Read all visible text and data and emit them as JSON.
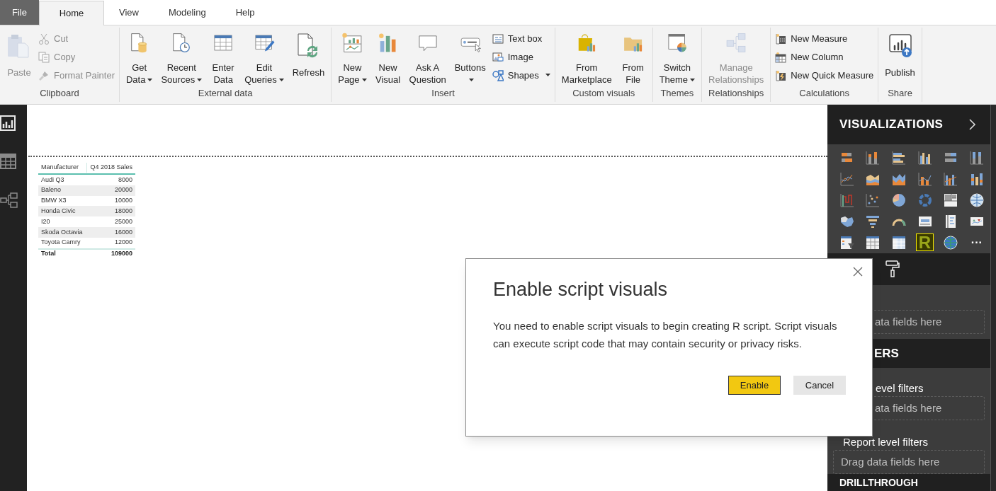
{
  "tabs": [
    {
      "label": "File",
      "kind": "file",
      "selected": false
    },
    {
      "label": "Home",
      "kind": "tab",
      "selected": true
    },
    {
      "label": "View",
      "kind": "tab",
      "selected": false
    },
    {
      "label": "Modeling",
      "kind": "tab",
      "selected": false
    },
    {
      "label": "Help",
      "kind": "tab",
      "selected": false
    }
  ],
  "ribbon": {
    "groups": [
      {
        "label": "Clipboard",
        "items": [
          {
            "kind": "large",
            "lines": [
              "Paste"
            ],
            "dropdown": false,
            "disabled": true
          },
          {
            "kind": "stack",
            "items": [
              {
                "label": "Cut",
                "dropdown": false,
                "disabled": true
              },
              {
                "label": "Copy",
                "dropdown": false,
                "disabled": true
              },
              {
                "label": "Format Painter",
                "dropdown": false,
                "disabled": true
              }
            ]
          }
        ]
      },
      {
        "label": "External data",
        "items": [
          {
            "kind": "large",
            "lines": [
              "Get",
              "Data"
            ],
            "dropdown": true,
            "disabled": false
          },
          {
            "kind": "large",
            "lines": [
              "Recent",
              "Sources"
            ],
            "dropdown": true,
            "disabled": false
          },
          {
            "kind": "large",
            "lines": [
              "Enter",
              "Data"
            ],
            "dropdown": false,
            "disabled": false
          },
          {
            "kind": "large",
            "lines": [
              "Edit",
              "Queries"
            ],
            "dropdown": true,
            "disabled": false
          },
          {
            "kind": "large",
            "lines": [
              "Refresh"
            ],
            "dropdown": false,
            "disabled": false
          }
        ]
      },
      {
        "label": "Insert",
        "items": [
          {
            "kind": "large",
            "lines": [
              "New",
              "Page"
            ],
            "dropdown": true,
            "disabled": false
          },
          {
            "kind": "large",
            "lines": [
              "New",
              "Visual"
            ],
            "dropdown": false,
            "disabled": false
          },
          {
            "kind": "large",
            "lines": [
              "Ask A",
              "Question"
            ],
            "dropdown": false,
            "disabled": false
          },
          {
            "kind": "large",
            "lines": [
              "Buttons"
            ],
            "dropdown": true,
            "disabled": false
          },
          {
            "kind": "stack",
            "items": [
              {
                "label": "Text box",
                "dropdown": false,
                "disabled": false
              },
              {
                "label": "Image",
                "dropdown": false,
                "disabled": false
              },
              {
                "label": "Shapes",
                "dropdown": true,
                "disabled": false
              }
            ]
          }
        ]
      },
      {
        "label": "Custom visuals",
        "items": [
          {
            "kind": "large",
            "lines": [
              "From",
              "Marketplace"
            ],
            "dropdown": false,
            "disabled": false
          },
          {
            "kind": "large",
            "lines": [
              "From",
              "File"
            ],
            "dropdown": false,
            "disabled": false
          }
        ]
      },
      {
        "label": "Themes",
        "items": [
          {
            "kind": "large",
            "lines": [
              "Switch",
              "Theme"
            ],
            "dropdown": true,
            "disabled": false
          }
        ]
      },
      {
        "label": "Relationships",
        "items": [
          {
            "kind": "large",
            "lines": [
              "Manage",
              "Relationships"
            ],
            "dropdown": false,
            "disabled": true
          }
        ]
      },
      {
        "label": "Calculations",
        "items": [
          {
            "kind": "stack",
            "items": [
              {
                "label": "New Measure",
                "dropdown": false,
                "disabled": false
              },
              {
                "label": "New Column",
                "dropdown": false,
                "disabled": false
              },
              {
                "label": "New Quick Measure",
                "dropdown": false,
                "disabled": false
              }
            ]
          }
        ]
      },
      {
        "label": "Share",
        "items": [
          {
            "kind": "large",
            "lines": [
              "Publish"
            ],
            "dropdown": false,
            "disabled": false
          }
        ]
      }
    ]
  },
  "left_rail": [
    {
      "selected": true
    },
    {
      "selected": false
    },
    {
      "selected": false
    }
  ],
  "table_visual": {
    "columns": [
      "Manufacturer",
      "Q4 2018 Sales"
    ],
    "rows": [
      [
        "Audi Q3",
        "8000"
      ],
      [
        "Baleno",
        "20000"
      ],
      [
        "BMW X3",
        "10000"
      ],
      [
        "Honda Civic",
        "18000"
      ],
      [
        "I20",
        "25000"
      ],
      [
        "Skoda Octavia",
        "16000"
      ],
      [
        "Toyota Camry",
        "12000"
      ]
    ],
    "total": [
      "Total",
      "109000"
    ]
  },
  "visualizations": {
    "title": "VISUALIZATIONS",
    "items": [
      {
        "selected": false
      },
      {
        "selected": false
      },
      {
        "selected": false
      },
      {
        "selected": false
      },
      {
        "selected": false
      },
      {
        "selected": false
      },
      {
        "selected": false
      },
      {
        "selected": false
      },
      {
        "selected": false
      },
      {
        "selected": false
      },
      {
        "selected": false
      },
      {
        "selected": false
      },
      {
        "selected": false
      },
      {
        "selected": false
      },
      {
        "selected": false
      },
      {
        "selected": false
      },
      {
        "selected": false
      },
      {
        "selected": false
      },
      {
        "selected": false
      },
      {
        "selected": false
      },
      {
        "selected": false
      },
      {
        "selected": false
      },
      {
        "selected": false
      },
      {
        "selected": false
      },
      {
        "selected": false
      },
      {
        "selected": false
      },
      {
        "selected": false
      },
      {
        "selected": true,
        "glyph": "R"
      },
      {
        "selected": false
      },
      {
        "selected": false,
        "glyph": "···"
      }
    ]
  },
  "fields_well": {
    "hint": "ata fields here",
    "partly_hidden": true
  },
  "filters": {
    "heading": "ERS",
    "heading_partly_hidden": true,
    "sections": [
      {
        "label": "evel filters",
        "hint": "ata fields here",
        "partly_hidden": true
      },
      {
        "label": "Report level filters",
        "hint": "Drag data fields here",
        "partly_hidden": false
      }
    ]
  },
  "drillthrough_heading": "DRILLTHROUGH",
  "dialog": {
    "title": "Enable script visuals",
    "message": "You need to enable script visuals to begin creating R script. Script visuals can execute script code that may contain security or privacy risks.",
    "buttons": [
      {
        "label": "Enable",
        "kind": "primary"
      },
      {
        "label": "Cancel",
        "kind": "secondary"
      }
    ]
  }
}
